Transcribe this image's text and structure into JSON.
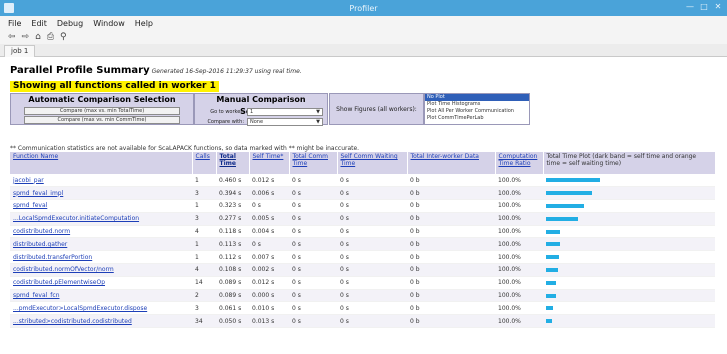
{
  "window": {
    "title": "Profiler"
  },
  "menu": [
    "File",
    "Edit",
    "Debug",
    "Window",
    "Help"
  ],
  "toolbar": {
    "back": "⇦",
    "forward": "⇨",
    "home": "⌂",
    "print": "⎙",
    "find": "⚲"
  },
  "tab": {
    "label": "job 1"
  },
  "page": {
    "title": "Parallel Profile Summary",
    "generated": "Generated 16-Sep-2016 11:29:37 using real time.",
    "subtitle": "Showing all functions called in worker 1",
    "auto_heading": "Automatic Comparison Selection",
    "auto_btn1": "Compare (max vs. min TotalTime)",
    "auto_btn2": "Compare (max vs. min CommTime)",
    "manual_heading": "Manual Comparison Selection",
    "goto_label": "Go to worker:",
    "goto_value": "1",
    "compare_label": "Compare with:",
    "compare_value": "None",
    "show_figures": "Show Figures (all workers):",
    "figures": [
      "No Plot",
      "Plot Time Histograms",
      "Plot All Per Worker Communication",
      "Plot CommTimePerLab"
    ],
    "figures_selected": 0,
    "note": "** Communication statistics are not available for ScaLAPACK functions, so data marked with ** might be inaccurate."
  },
  "columns": [
    "Function Name",
    "Calls",
    "Total Time",
    "Self Time*",
    "Total Comm Time",
    "Self Comm Waiting Time",
    "Total Inter-worker Data",
    "Computation Time Ratio",
    "Total Time Plot (dark band = self time and orange time = self waiting time)"
  ],
  "rows": [
    {
      "name": "jacobi_par",
      "calls": "1",
      "total": "0.460 s",
      "self": "0.012 s",
      "tcomm": "0 s",
      "scomm": "0 s",
      "data": "0 b",
      "ratio": "100.0%",
      "bar": 1.0
    },
    {
      "name": "spmd_feval_impl",
      "calls": "3",
      "total": "0.394 s",
      "self": "0.006 s",
      "tcomm": "0 s",
      "scomm": "0 s",
      "data": "0 b",
      "ratio": "100.0%",
      "bar": 0.86
    },
    {
      "name": "spmd_feval",
      "calls": "1",
      "total": "0.323 s",
      "self": "0 s",
      "tcomm": "0 s",
      "scomm": "0 s",
      "data": "0 b",
      "ratio": "100.0%",
      "bar": 0.7
    },
    {
      "name": "...LocalSpmdExecutor.initiateComputation",
      "calls": "3",
      "total": "0.277 s",
      "self": "0.005 s",
      "tcomm": "0 s",
      "scomm": "0 s",
      "data": "0 b",
      "ratio": "100.0%",
      "bar": 0.6
    },
    {
      "name": "codistributed.norm",
      "calls": "4",
      "total": "0.118 s",
      "self": "0.004 s",
      "tcomm": "0 s",
      "scomm": "0 s",
      "data": "0 b",
      "ratio": "100.0%",
      "bar": 0.26
    },
    {
      "name": "distributed.gather",
      "calls": "1",
      "total": "0.113 s",
      "self": "0 s",
      "tcomm": "0 s",
      "scomm": "0 s",
      "data": "0 b",
      "ratio": "100.0%",
      "bar": 0.25
    },
    {
      "name": "distributed.transferPortion",
      "calls": "1",
      "total": "0.112 s",
      "self": "0.007 s",
      "tcomm": "0 s",
      "scomm": "0 s",
      "data": "0 b",
      "ratio": "100.0%",
      "bar": 0.24
    },
    {
      "name": "codistributed.normOfVector/norm",
      "calls": "4",
      "total": "0.108 s",
      "self": "0.002 s",
      "tcomm": "0 s",
      "scomm": "0 s",
      "data": "0 b",
      "ratio": "100.0%",
      "bar": 0.23
    },
    {
      "name": "codistributed.pElementwiseOp",
      "calls": "14",
      "total": "0.089 s",
      "self": "0.012 s",
      "tcomm": "0 s",
      "scomm": "0 s",
      "data": "0 b",
      "ratio": "100.0%",
      "bar": 0.19
    },
    {
      "name": "spmd_feval_fcn",
      "calls": "2",
      "total": "0.089 s",
      "self": "0.000 s",
      "tcomm": "0 s",
      "scomm": "0 s",
      "data": "0 b",
      "ratio": "100.0%",
      "bar": 0.19
    },
    {
      "name": "...pmdExecutor>LocalSpmdExecutor.dispose",
      "calls": "3",
      "total": "0.061 s",
      "self": "0.010 s",
      "tcomm": "0 s",
      "scomm": "0 s",
      "data": "0 b",
      "ratio": "100.0%",
      "bar": 0.13
    },
    {
      "name": "...stributed>codistributed.codistributed",
      "calls": "34",
      "total": "0.050 s",
      "self": "0.013 s",
      "tcomm": "0 s",
      "scomm": "0 s",
      "data": "0 b",
      "ratio": "100.0%",
      "bar": 0.11
    }
  ]
}
